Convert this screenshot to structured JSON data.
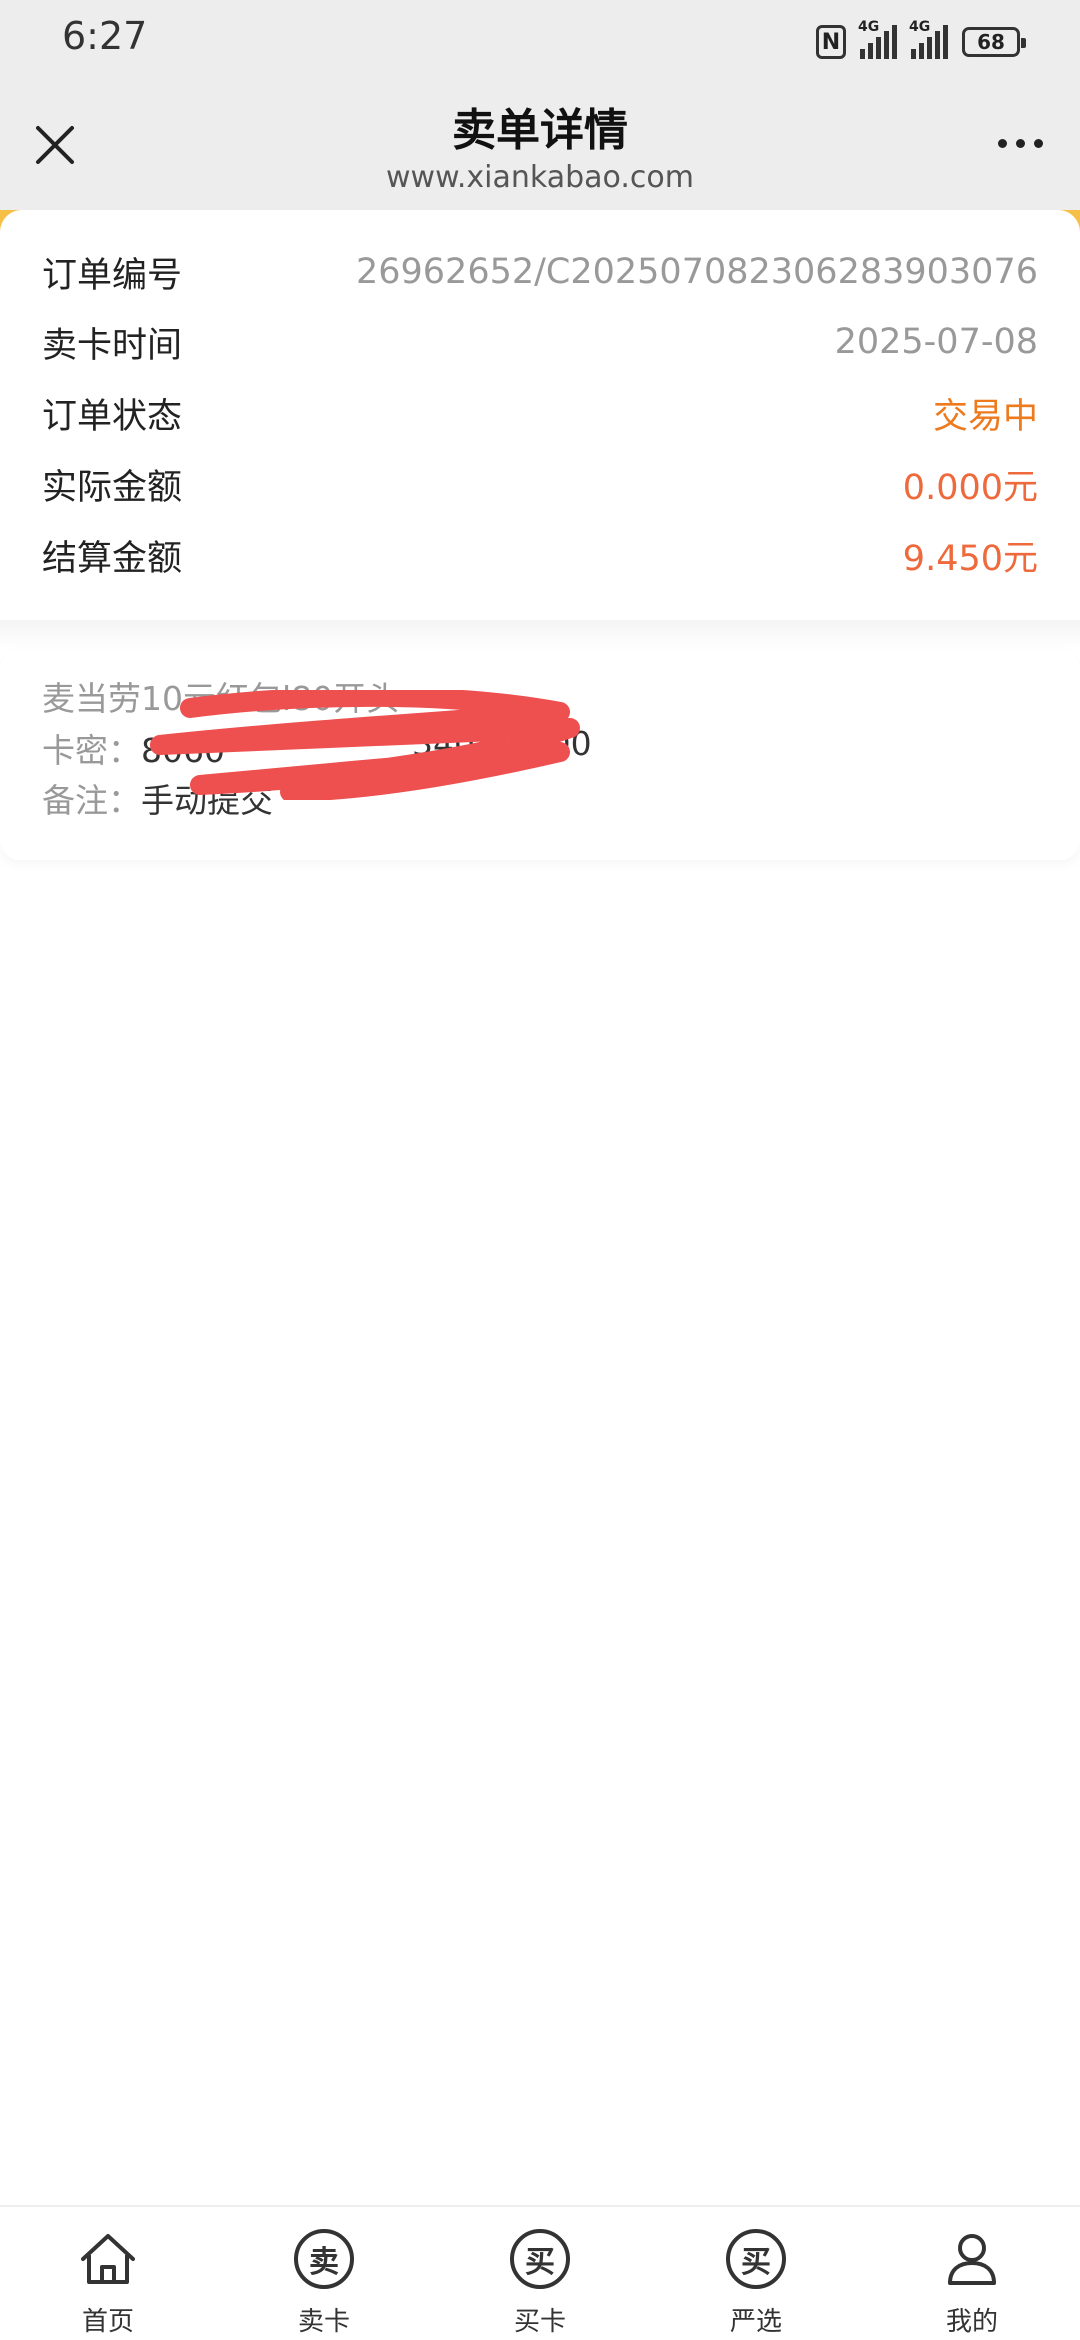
{
  "status": {
    "time": "6:27",
    "battery": "68",
    "net1": "4G",
    "net2": "4G"
  },
  "header": {
    "title": "卖单详情",
    "url": "www.xiankabao.com"
  },
  "order": {
    "id_label": "订单编号",
    "id_value": "26962652/C202507082306283903076",
    "time_label": "卖卡时间",
    "time_value": "2025-07-08",
    "status_label": "订单状态",
    "status_value": "交易中",
    "actual_label": "实际金额",
    "actual_value": "0.000元",
    "settle_label": "结算金额",
    "settle_value": "9.450元"
  },
  "card": {
    "product": "麦当劳10元红包l80开头",
    "pin_label": "卡密：",
    "pin_value": "8060",
    "pin_value_tail": "34010W00",
    "remark_label": "备注：",
    "remark_value": "手动提交"
  },
  "tabs": [
    {
      "label": "首页",
      "icon": "home-icon"
    },
    {
      "label": "卖卡",
      "icon": "sell-icon",
      "glyph": "卖"
    },
    {
      "label": "买卡",
      "icon": "buy-icon",
      "glyph": "买"
    },
    {
      "label": "严选",
      "icon": "select-icon",
      "glyph": "买"
    },
    {
      "label": "我的",
      "icon": "profile-icon"
    }
  ],
  "colors": {
    "accent": "#f6c046",
    "status": "#ee7a1e",
    "amount": "#ee6a3c",
    "scribble": "#ee4f4f"
  }
}
